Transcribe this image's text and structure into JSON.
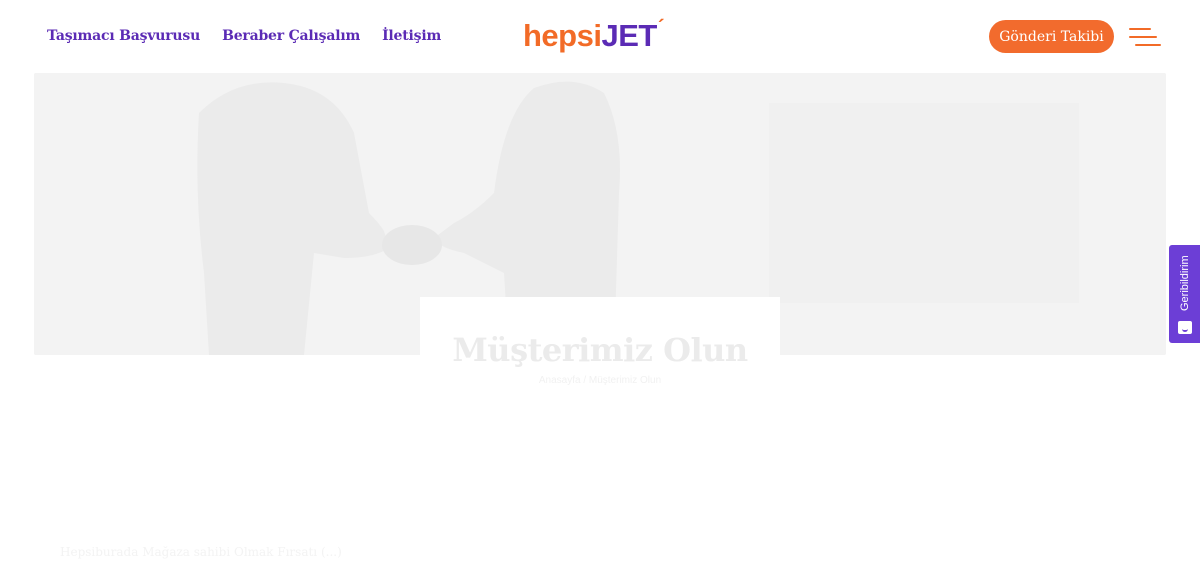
{
  "nav": {
    "items": [
      {
        "label": "Taşımacı Başvurusu"
      },
      {
        "label": "Beraber Çalışalım"
      },
      {
        "label": "İletişim"
      }
    ]
  },
  "logo": {
    "part1": "hepsi",
    "part2": "JET",
    "tick": "´"
  },
  "header": {
    "track_label": "Gönderi Takibi"
  },
  "hero": {
    "title": "Müşterimiz Olun",
    "breadcrumb": "Anasayfa  /  Müşterimiz Olun"
  },
  "feedback": {
    "label": "Geribildirim"
  },
  "footer_text": "Hepsiburada Mağaza sahibi Olmak Fırsatı (...)",
  "colors": {
    "brand_orange": "#f26b27",
    "brand_purple": "#5b2bb5",
    "feedback_purple": "#6c3ed6"
  }
}
